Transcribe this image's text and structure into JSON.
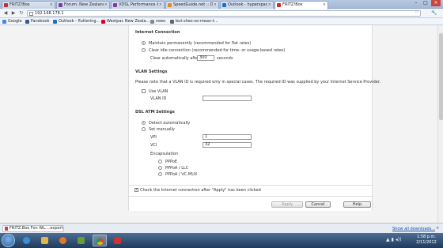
{
  "browser": {
    "tabs": [
      {
        "title": "FRITZ!Box",
        "color": "#c62f2f"
      },
      {
        "title": "Forum: New Zealand Broa",
        "color": "#7b3f9a"
      },
      {
        "title": "VDSL Performance & Tun",
        "color": "#7b3f9a"
      },
      {
        "title": "SpeedGuide.net :: DSL Spee",
        "color": "#e08a1e"
      },
      {
        "title": "Outlook - hyperspace2007",
        "color": "#1f6fc5"
      },
      {
        "title": "FRITZ!Box",
        "color": "#c62f2f"
      }
    ],
    "address": "192.168.178.1",
    "bookmarks": [
      {
        "label": "Google",
        "color": "#4a86e8"
      },
      {
        "label": "Facebook",
        "color": "#3b5998"
      },
      {
        "label": "Outlook - fluttering...",
        "color": "#1f6fc5"
      },
      {
        "label": "Westpac New Zeala...",
        "color": "#d5002b"
      },
      {
        "label": "rewo",
        "color": "#888888"
      },
      {
        "label": "but-shes-so-mean-t...",
        "color": "#666666"
      }
    ]
  },
  "internet_connection": {
    "title": "Internet Connection",
    "opt_permanent": "Maintain permanently (recommended for flat rates)",
    "opt_idle": "Clear idle connection (recommended for time- or usage-based rates)",
    "clear_after_label": "Clear automatically after",
    "clear_after_value": "300",
    "clear_after_unit": "seconds"
  },
  "vlan": {
    "title": "VLAN Settings",
    "note": "Please note that a VLAN ID is required only in special cases. The required ID was supplied by your Internet Service Provider.",
    "use_vlan_label": "Use VLAN",
    "vlan_id_label": "VLAN ID",
    "vlan_id_value": ""
  },
  "dsl_atm": {
    "title": "DSL ATM Settings",
    "opt_detect": "Detect automatically",
    "opt_manual": "Set manually",
    "vpi_label": "VPI",
    "vpi_value": "1",
    "vci_label": "VCI",
    "vci_value": "32",
    "encapsulation_label": "Encapsulation",
    "enc_pppoe": "PPPoE",
    "enc_pppoa_llc": "PPPoA / LLC",
    "enc_pppoa_vcmux": "PPPoA / VC-MUX"
  },
  "check_connection": "Check the Internet connection after \"Apply\" has been clicked",
  "buttons": {
    "apply": "Apply",
    "cancel": "Cancel",
    "help": "Help"
  },
  "downloads": {
    "file": "FRITZ.Box Fon WL....export",
    "show_all": "Show all downloads..."
  },
  "taskbar": {
    "time": "1:58 p.m.",
    "date": "2/11/2012"
  }
}
